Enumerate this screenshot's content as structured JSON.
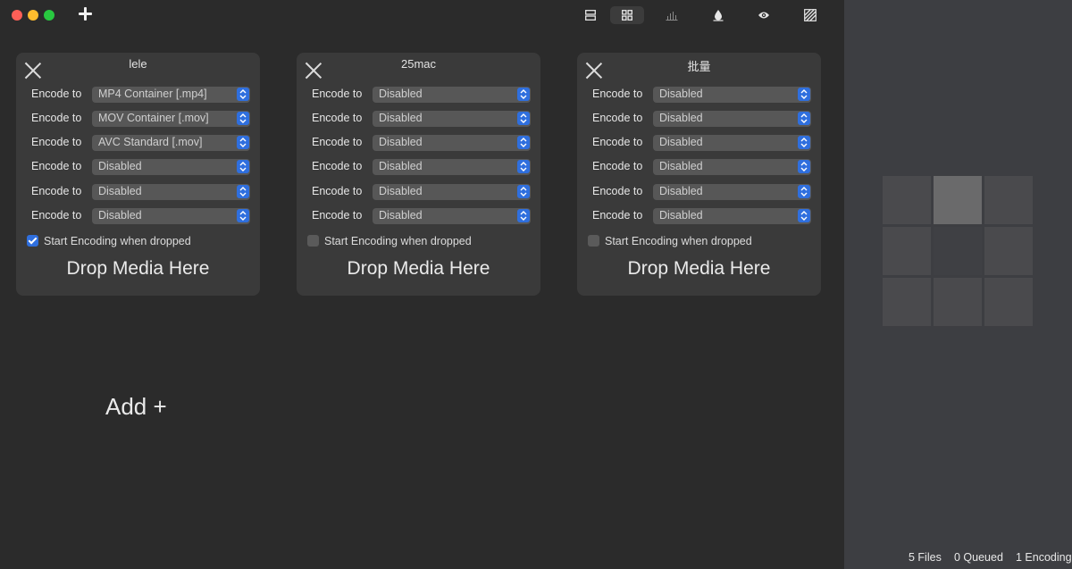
{
  "toolbar": {
    "icons": [
      "layout-rows-icon",
      "layout-grid-icon",
      "chart-bars-icon",
      "droplet-icon",
      "eye-icon",
      "striped-square-icon"
    ],
    "active": "layout-grid-icon"
  },
  "add_label": "Add +",
  "colors": {
    "accent": "#2f6fde",
    "background": "#2b2b2b",
    "card": "#3a3a3a",
    "sidebar": "#3d3e42"
  },
  "cards": [
    {
      "title": "lele",
      "rows": [
        {
          "label": "Encode to",
          "value": "MP4 Container [.mp4]"
        },
        {
          "label": "Encode to",
          "value": "MOV Container [.mov]"
        },
        {
          "label": "Encode to",
          "value": "AVC Standard [.mov]"
        },
        {
          "label": "Encode to",
          "value": "Disabled"
        },
        {
          "label": "Encode to",
          "value": "Disabled"
        },
        {
          "label": "Encode to",
          "value": "Disabled"
        }
      ],
      "start_label": "Start Encoding when dropped",
      "start_checked": true,
      "drop_label": "Drop Media Here"
    },
    {
      "title": "25mac",
      "rows": [
        {
          "label": "Encode to",
          "value": "Disabled"
        },
        {
          "label": "Encode to",
          "value": "Disabled"
        },
        {
          "label": "Encode to",
          "value": "Disabled"
        },
        {
          "label": "Encode to",
          "value": "Disabled"
        },
        {
          "label": "Encode to",
          "value": "Disabled"
        },
        {
          "label": "Encode to",
          "value": "Disabled"
        }
      ],
      "start_label": "Start Encoding when dropped",
      "start_checked": false,
      "drop_label": "Drop Media Here"
    },
    {
      "title": "批量",
      "rows": [
        {
          "label": "Encode to",
          "value": "Disabled"
        },
        {
          "label": "Encode to",
          "value": "Disabled"
        },
        {
          "label": "Encode to",
          "value": "Disabled"
        },
        {
          "label": "Encode to",
          "value": "Disabled"
        },
        {
          "label": "Encode to",
          "value": "Disabled"
        },
        {
          "label": "Encode to",
          "value": "Disabled"
        }
      ],
      "start_label": "Start Encoding when dropped",
      "start_checked": false,
      "drop_label": "Drop Media Here"
    }
  ],
  "status": {
    "files": "5 Files",
    "queued": "0 Queued",
    "encoding": "1 Encoding"
  }
}
